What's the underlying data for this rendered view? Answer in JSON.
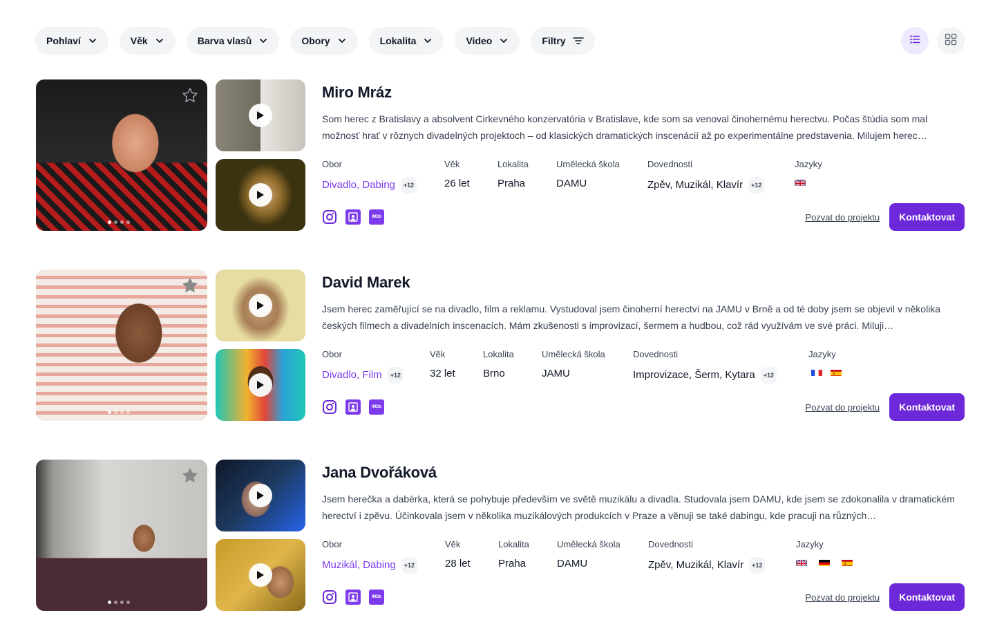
{
  "filters": [
    {
      "label": "Pohlaví"
    },
    {
      "label": "Věk"
    },
    {
      "label": "Barva vlasů"
    },
    {
      "label": "Obory"
    },
    {
      "label": "Lokalita"
    },
    {
      "label": "Video"
    },
    {
      "label": "Filtry"
    }
  ],
  "view": {
    "active": "list",
    "list_icon": "list-icon",
    "grid_icon": "grid-icon"
  },
  "labels": {
    "obor": "Obor",
    "vek": "Věk",
    "lokalita": "Lokalita",
    "skola": "Umělecká škola",
    "dovednosti": "Dovednosti",
    "jazyky": "Jazyky",
    "invite": "Pozvat do projektu",
    "contact": "Kontaktovat"
  },
  "profiles": [
    {
      "name": "Miro Mráz",
      "bio": "Som herec z Bratislavy a absolvent Cirkevného konzervatória v Bratislave, kde som sa venoval činohernému herectvu. Počas štúdia som mal možnosť hrať v rôznych divadelných projektoch – od klasických dramatických inscenácií až po experimentálne predstavenia. Milujem herec…",
      "obor": "Divadlo, Dabing",
      "obor_more": "+12",
      "vek": "26 let",
      "lokalita": "Praha",
      "skola": "DAMU",
      "dovednosti": "Zpěv, Muzikál, Klavír",
      "dovednosti_more": "+12",
      "jazyky": [
        "gb"
      ],
      "favorite": false
    },
    {
      "name": "David Marek",
      "bio": "Jsem herec zaměřující se na divadlo, film a reklamu. Vystudoval jsem činoherní herectví na JAMU v Brně a od té doby jsem se objevil v několika českých filmech a divadelních inscenacích. Mám zkušenosti s improvizací, šermem a hudbou, což rád využívám ve své práci. Miluji…",
      "obor": "Divadlo, Film",
      "obor_more": "+12",
      "vek": "32 let",
      "lokalita": "Brno",
      "skola": "JAMU",
      "dovednosti": "Improvizace, Šerm, Kytara",
      "dovednosti_more": "+12",
      "jazyky": [
        "fr",
        "es"
      ],
      "favorite": true
    },
    {
      "name": "Jana Dvořáková",
      "bio": "Jsem herečka a dabérka, která se pohybuje především ve světě muzikálu a divadla. Studovala jsem DAMU, kde jsem se zdokonalila v dramatickém herectví i zpěvu. Účinkovala jsem v několika muzikálových produkcích v Praze a věnuji se také dabingu, kde pracuji na různých…",
      "obor": "Muzikál, Dabing",
      "obor_more": "+12",
      "vek": "28 let",
      "lokalita": "Praha",
      "skola": "DAMU",
      "dovednosti": "Zpěv, Muzikál, Klavír",
      "dovednosti_more": "+12",
      "jazyky": [
        "gb",
        "de",
        "es"
      ],
      "favorite": true
    }
  ],
  "colors": {
    "accent": "#6d28d9",
    "accent_text": "#7c3aed",
    "pill_bg": "#f3f4f6"
  }
}
